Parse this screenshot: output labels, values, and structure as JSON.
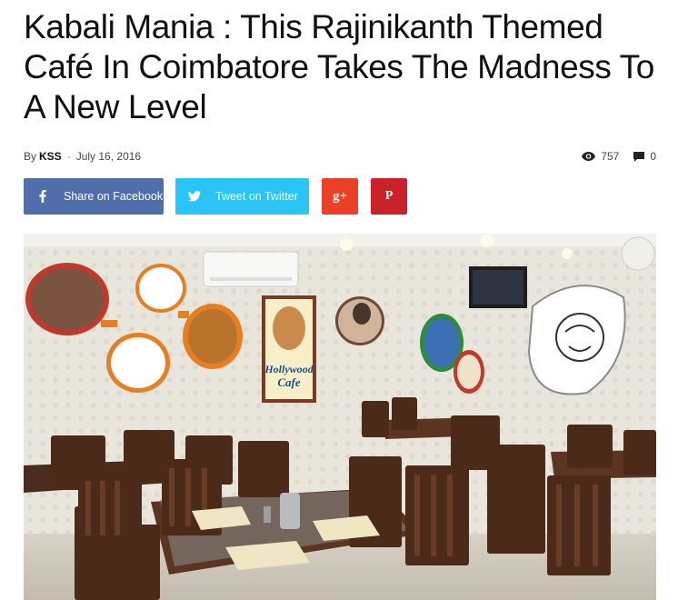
{
  "article": {
    "title": "Kabali Mania : This Rajinikanth Themed Café In Coimbatore Takes The Madness To A New Level",
    "by_label": "By",
    "author": "KSS",
    "separator": "-",
    "date": "July 16, 2016",
    "views": "757",
    "comments": "0"
  },
  "share": {
    "facebook_label": "Share on Facebook",
    "twitter_label": "Tweet on Twitter",
    "googleplus_glyph": "g+",
    "pinterest_glyph": "P"
  },
  "icons": {
    "views": "eye-icon",
    "comments": "comment-icon",
    "facebook": "facebook-icon",
    "twitter": "twitter-icon",
    "googleplus": "google-plus-icon",
    "pinterest": "pinterest-icon"
  },
  "image": {
    "cafe_sign_line1": "Hollywood",
    "cafe_sign_line2": "Cafe"
  },
  "colors": {
    "facebook": "#516eab",
    "twitter": "#29c5f6",
    "googleplus": "#eb4026",
    "pinterest": "#ca212a"
  }
}
